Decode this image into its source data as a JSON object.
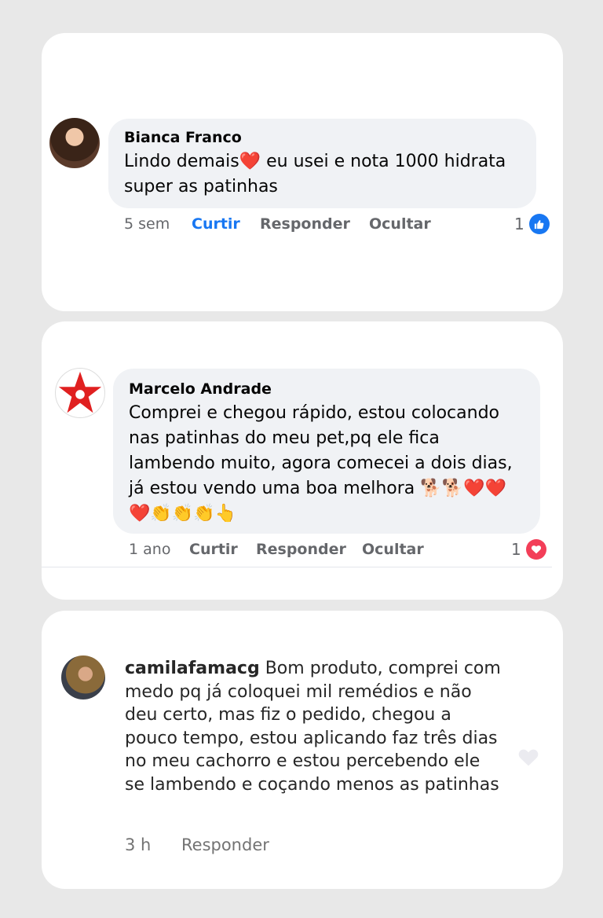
{
  "comments": [
    {
      "author": "Bianca Franco",
      "text": "Lindo demais❤️  eu usei e nota 1000  hidrata super as patinhas",
      "time": "5 sem",
      "like_label": "Curtir",
      "reply_label": "Responder",
      "hide_label": "Ocultar",
      "reaction_count": "1",
      "reaction_type": "like",
      "like_active": true
    },
    {
      "author": "Marcelo Andrade",
      "text": "Comprei e chegou rápido, estou colocando nas patinhas do meu pet,pq ele fica lambendo muito, agora comecei a dois dias, já estou vendo uma boa melhora 🐕🐕❤️❤️❤️👏👏👏👆",
      "time": "1 ano",
      "like_label": "Curtir",
      "reply_label": "Responder",
      "hide_label": "Ocultar",
      "reaction_count": "1",
      "reaction_type": "love",
      "like_active": false
    },
    {
      "author": "camilafamacg",
      "text": "Bom produto, comprei com medo pq já coloquei mil remédios e não deu certo, mas fiz o pedido, chegou a pouco tempo, estou aplicando faz três dias no meu cachorro e estou percebendo ele se lambendo e coçando menos as patinhas",
      "time": "3 h",
      "reply_label": "Responder"
    }
  ],
  "colors": {
    "facebook_blue": "#1877f2",
    "love_red": "#f33e58",
    "bubble_gray": "#f0f2f5",
    "page_background": "#e8e8e8"
  },
  "icons": {
    "like_reaction": "thumbs-up-icon",
    "love_reaction": "heart-icon",
    "instagram_like": "heart-outline-icon"
  }
}
